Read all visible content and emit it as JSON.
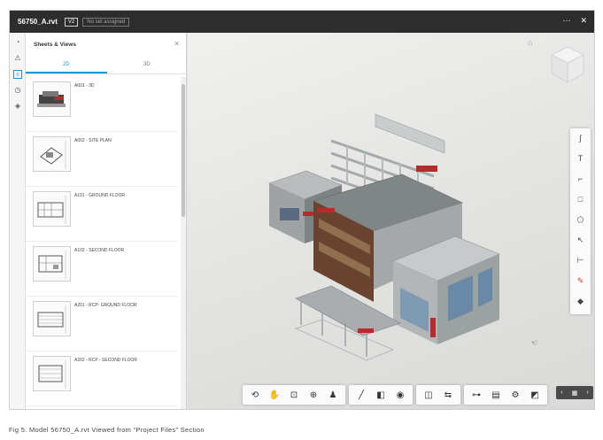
{
  "window": {
    "title": "56750_A.rvt",
    "version_badge": "V2",
    "set_badge": "No set assigned",
    "more_icon": "more-icon",
    "close_icon": "close-icon"
  },
  "left_rail": {
    "items": [
      "activity-icon",
      "warning-icon",
      "sheets-icon",
      "history-icon",
      "layers-icon"
    ]
  },
  "panel": {
    "title": "Sheets & Views",
    "tabs": [
      {
        "label": "2D",
        "active": true
      },
      {
        "label": "3D",
        "active": false
      }
    ],
    "sheets": [
      {
        "label": "A001 - 3D"
      },
      {
        "label": "A002 - SITE PLAN"
      },
      {
        "label": "A101 - GROUND FLOOR"
      },
      {
        "label": "A102 - SECOND FLOOR"
      },
      {
        "label": "A201 - RCP- GROUND FLOOR"
      },
      {
        "label": "A202 - RCP - SECOND FLOOR"
      }
    ]
  },
  "viewcube": {
    "face": "TOP"
  },
  "markup_tools": [
    "freehand-icon",
    "text-icon",
    "callout-icon",
    "rectangle-icon",
    "polygon-icon",
    "arrow-icon",
    "dimension-icon",
    "color-icon",
    "fill-icon"
  ],
  "toolbar": {
    "groups": [
      [
        "orbit-icon",
        "pan-icon",
        "fit-icon",
        "zoom-window-icon",
        "first-person-icon"
      ],
      [
        "measure-icon",
        "section-icon",
        "visibility-icon"
      ],
      [
        "split-icon",
        "compare-icon"
      ],
      [
        "model-browser-icon",
        "properties-icon",
        "settings-icon",
        "fullscreen-icon"
      ]
    ]
  },
  "caption": "Fig 5. Model 56750_A.rvt Viewed from “Project Files” Section",
  "colors": {
    "titlebar": "#2d2d2d",
    "accent": "#1a96d4",
    "brick": "#6a4330",
    "red_band": "#b62c2c"
  }
}
